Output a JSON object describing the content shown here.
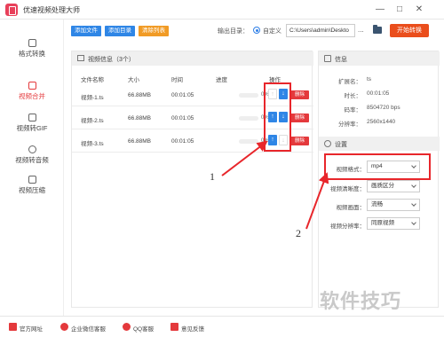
{
  "window": {
    "title": "优速视频处理大师"
  },
  "toolbar": {
    "add_file": "添加文件",
    "add_dir": "添加目录",
    "clear_list": "清除列表",
    "output_label": "输出目录：",
    "custom_label": "自定义",
    "output_path": "C:\\Users\\admin\\Deskto",
    "browse": "...",
    "start": "开始转换"
  },
  "sidebar": {
    "items": [
      {
        "label": "格式转换",
        "active": false,
        "icon": "convert-icon"
      },
      {
        "label": "视频合并",
        "active": true,
        "icon": "merge-icon"
      },
      {
        "label": "视频转GIF",
        "active": false,
        "icon": "gif-icon"
      },
      {
        "label": "视频转音频",
        "active": false,
        "icon": "audio-icon"
      },
      {
        "label": "视频压缩",
        "active": false,
        "icon": "compress-icon"
      }
    ]
  },
  "video_panel": {
    "title": "视频信息（3个）",
    "columns": [
      "文件名称",
      "大小",
      "时间",
      "进度",
      "操作"
    ],
    "delete_label": "删除",
    "rows": [
      {
        "name": "视频-1.ts",
        "size": "66.88MB",
        "time": "00:01:05",
        "progress": "0%"
      },
      {
        "name": "视频-2.ts",
        "size": "66.88MB",
        "time": "00:01:05",
        "progress": "0%"
      },
      {
        "name": "视频-3.ts",
        "size": "66.88MB",
        "time": "00:01:05",
        "progress": "0%"
      }
    ]
  },
  "info_panel": {
    "title": "信息",
    "rows": [
      {
        "key": "扩展名：",
        "value": "ts"
      },
      {
        "key": "时长：",
        "value": "00:01:05"
      },
      {
        "key": "码率：",
        "value": "8504720 bps"
      },
      {
        "key": "分辨率：",
        "value": "2560x1440"
      }
    ]
  },
  "settings_panel": {
    "title": "设置",
    "format": {
      "label": "视频格式：",
      "value": "mp4"
    },
    "clarity": {
      "label": "视频清晰度：",
      "value": "画质区分"
    },
    "picture": {
      "label": "视频画面：",
      "value": "流畅"
    },
    "resolution": {
      "label": "视频分辨率：",
      "value": "同原视频"
    }
  },
  "annotations": {
    "one": "1",
    "two": "2"
  },
  "footer": {
    "items": [
      "官方网址",
      "企业微信客服",
      "QQ客服",
      "意见反馈"
    ]
  },
  "watermark": "软件技巧",
  "colors": {
    "accent_red": "#e4393c",
    "start_orange": "#ea4e1c",
    "blue": "#2f86e6",
    "annotation": "#e8262b"
  }
}
